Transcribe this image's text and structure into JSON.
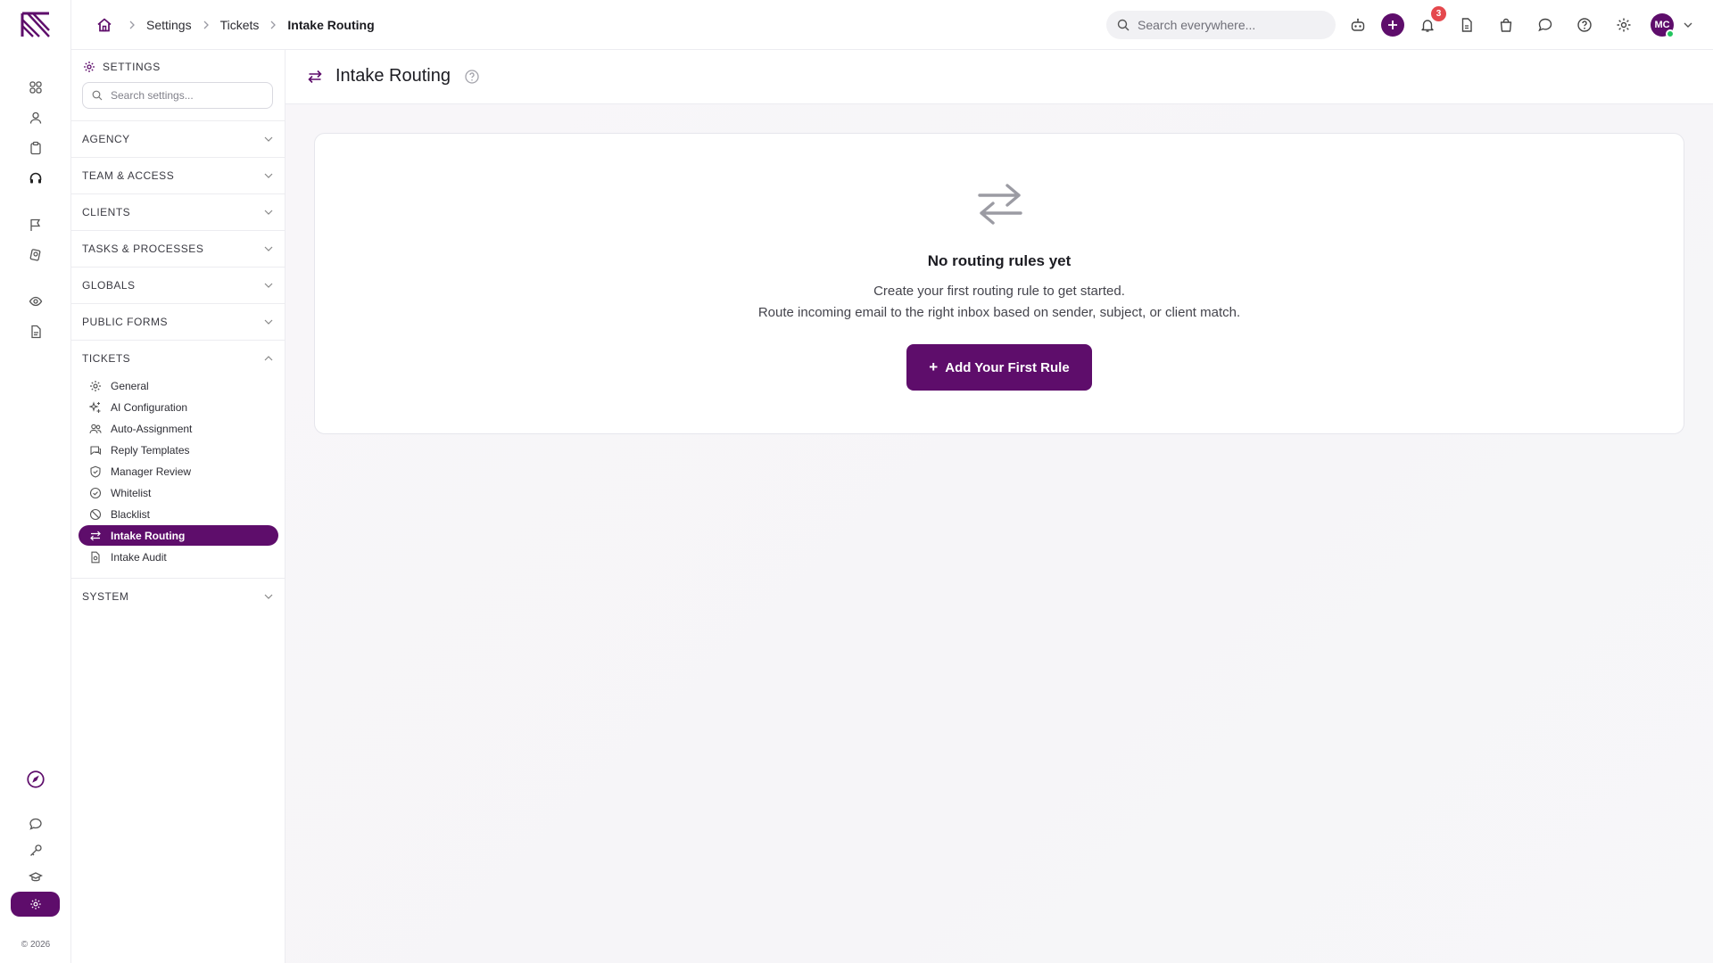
{
  "breadcrumbs": [
    "Settings",
    "Tickets",
    "Intake Routing"
  ],
  "search": {
    "placeholder": "Search everywhere..."
  },
  "notifications": {
    "count": "3"
  },
  "user": {
    "initials": "MC"
  },
  "footer": {
    "copyright": "© 2026"
  },
  "settings_sidebar": {
    "header": "SETTINGS",
    "search_placeholder": "Search settings...",
    "sections": [
      {
        "label": "AGENCY",
        "expanded": false
      },
      {
        "label": "TEAM & ACCESS",
        "expanded": false
      },
      {
        "label": "CLIENTS",
        "expanded": false
      },
      {
        "label": "TASKS & PROCESSES",
        "expanded": false
      },
      {
        "label": "GLOBALS",
        "expanded": false
      },
      {
        "label": "PUBLIC FORMS",
        "expanded": false
      },
      {
        "label": "TICKETS",
        "expanded": true
      },
      {
        "label": "SYSTEM",
        "expanded": false
      }
    ],
    "ticket_items": [
      {
        "label": "General",
        "icon": "gear-icon"
      },
      {
        "label": "AI Configuration",
        "icon": "sparkles-icon"
      },
      {
        "label": "Auto-Assignment",
        "icon": "users-icon"
      },
      {
        "label": "Reply Templates",
        "icon": "chat-reply-icon"
      },
      {
        "label": "Manager Review",
        "icon": "shield-check-icon"
      },
      {
        "label": "Whitelist",
        "icon": "check-circle-icon"
      },
      {
        "label": "Blacklist",
        "icon": "ban-icon"
      },
      {
        "label": "Intake Routing",
        "icon": "arrows-swap-icon",
        "active": true
      },
      {
        "label": "Intake Audit",
        "icon": "document-audit-icon"
      }
    ]
  },
  "page": {
    "title": "Intake Routing"
  },
  "empty_state": {
    "title": "No routing rules yet",
    "line1": "Create your first routing rule to get started.",
    "line2": "Route incoming email to the right inbox based on sender, subject, or client match.",
    "button_label": "Add Your First Rule",
    "button_icon": "+"
  },
  "colors": {
    "brand": "#5e0d6b",
    "badge": "#e5484d",
    "online": "#22c55e"
  }
}
